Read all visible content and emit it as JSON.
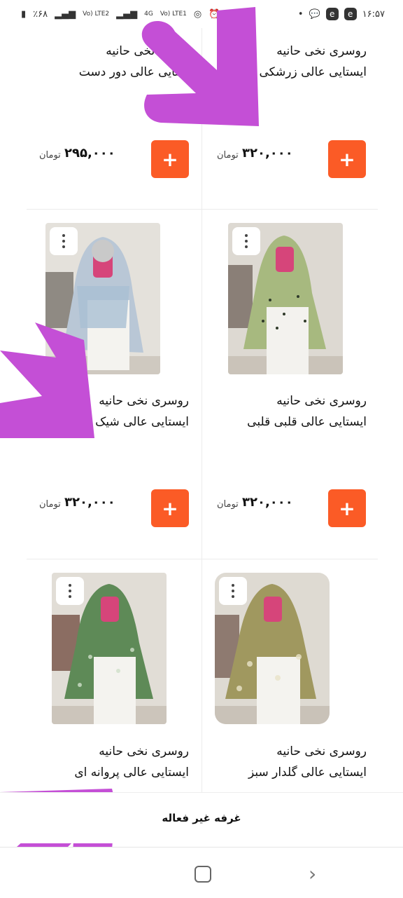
{
  "status_bar": {
    "battery": "٪۶۸",
    "net1": "Vo) LTE2",
    "net2": "4G",
    "net3": "Vo) LTE1",
    "time": "۱۶:۵۷"
  },
  "products": [
    {
      "title1": "روسری نخی حانیه",
      "title2": "ایستایی عالی دور دست",
      "price": "۲۹۵,۰۰۰",
      "currency": "تومان"
    },
    {
      "title1": "روسری نخی حانیه",
      "title2": "ایستایی عالی زرشکی",
      "price": "۳۲۰,۰۰۰",
      "currency": "تومان"
    },
    {
      "title1": "روسری نخی حانیه",
      "title2": "ایستایی عالی شیک",
      "price": "۳۲۰,۰۰۰",
      "currency": "تومان"
    },
    {
      "title1": "روسری نخی حانیه",
      "title2": "ایستایی عالی قلبی قلبی",
      "price": "۳۲۰,۰۰۰",
      "currency": "تومان"
    },
    {
      "title1": "روسری نخی حانیه",
      "title2": "ایستایی عالی پروانه ای",
      "price": "",
      "currency": ""
    },
    {
      "title1": "روسری نخی حانیه",
      "title2": "ایستایی عالی گلدار سبز",
      "price": "",
      "currency": ""
    }
  ],
  "add_label": "+",
  "banner_text": "غرفه غیر فعاله",
  "colors": {
    "accent": "#fb5b26",
    "annotation": "#c44fd6"
  }
}
